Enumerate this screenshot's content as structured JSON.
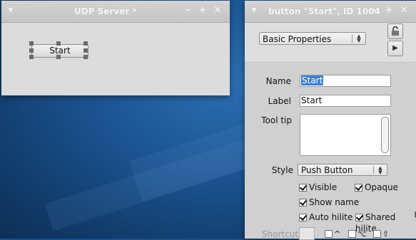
{
  "udp_window": {
    "title": "UDP Server *",
    "start_button_label": "Start"
  },
  "inspector_window": {
    "title": "button \"Start\", ID 1004",
    "properties_selector": "Basic Properties",
    "lock_icon": "unlock-icon",
    "play_icon": "play-icon",
    "fields": {
      "name_label": "Name",
      "name_value": "Start",
      "label_label": "Label",
      "label_value": "Start",
      "tooltip_label": "Tool tip",
      "tooltip_value": "",
      "style_label": "Style",
      "style_value": "Push Button"
    },
    "checkboxes": [
      {
        "label": "Visible",
        "checked": true
      },
      {
        "label": "Opaque",
        "checked": true
      },
      {
        "label": "Show name",
        "checked": true
      },
      {
        "label": "Auto hilite",
        "checked": true
      },
      {
        "label": "Shared hilite",
        "checked": true
      }
    ],
    "shortcut_label": "Shortcut",
    "modifier_glyphs": [
      "^",
      "⌥",
      "⇧"
    ]
  },
  "colors": {
    "desktop_blue": "#1c5593",
    "selection_blue": "#3b7fd3",
    "window_gray": "#dadada"
  }
}
